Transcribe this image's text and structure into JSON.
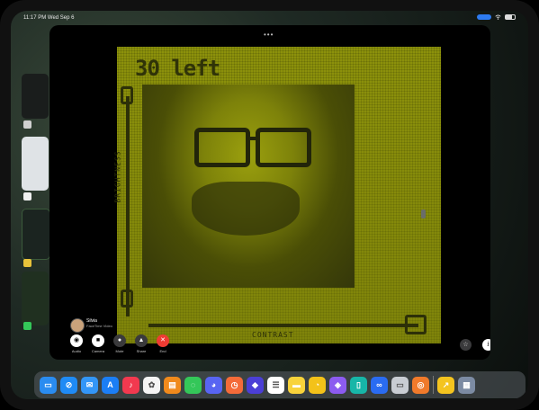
{
  "status": {
    "time": "11:17 PM   Wed Sep 6"
  },
  "camera": {
    "counter": "30 left",
    "brightness_label": "BRIGHTNESS",
    "contrast_label": "CONTRAST"
  },
  "facetime": {
    "caller_name": "Silvia",
    "caller_sub": "FaceTime Video",
    "buttons": [
      {
        "label": "Audio",
        "icon": "person-audio-icon",
        "glyph": "◉"
      },
      {
        "label": "Camera",
        "icon": "video-camera-icon",
        "glyph": "■"
      },
      {
        "label": "Mute",
        "icon": "microphone-icon",
        "glyph": "●"
      },
      {
        "label": "Share",
        "icon": "share-icon",
        "glyph": "▲"
      },
      {
        "label": "End",
        "icon": "close-icon",
        "glyph": "✕"
      }
    ]
  },
  "corner": {
    "settings_glyph": "☆",
    "info_glyph": "i"
  },
  "dock": {
    "apps": [
      {
        "name": "Files",
        "color": "#2a8cf0",
        "glyph": "▭"
      },
      {
        "name": "Safari",
        "color": "#1f8bf5",
        "glyph": "⊘"
      },
      {
        "name": "Mail",
        "color": "#3396f7",
        "glyph": "✉"
      },
      {
        "name": "App Store",
        "color": "#1b7ef5",
        "glyph": "A"
      },
      {
        "name": "Music",
        "color": "#f2394f",
        "glyph": "♪"
      },
      {
        "name": "Photos",
        "color": "#f4f4f4",
        "glyph": "✿"
      },
      {
        "name": "Books",
        "color": "#f08a1c",
        "glyph": "▤"
      },
      {
        "name": "Messages",
        "color": "#34c759",
        "glyph": "◌",
        "badge": "2"
      },
      {
        "name": "Discord",
        "color": "#5865f2",
        "glyph": "◕"
      },
      {
        "name": "Screen Time",
        "color": "#f46b39",
        "glyph": "◷"
      },
      {
        "name": "Shortcuts",
        "color": "#4b3fd6",
        "glyph": "◆"
      },
      {
        "name": "Reminders",
        "color": "#ffffff",
        "glyph": "☰"
      },
      {
        "name": "Notes",
        "color": "#f8d33b",
        "glyph": "▬"
      },
      {
        "name": "Clock",
        "color": "#f3c219",
        "glyph": "◔"
      },
      {
        "name": "Mastodon",
        "color": "#8c5bf0",
        "glyph": "◈"
      },
      {
        "name": "Frame",
        "color": "#17b6a8",
        "glyph": "▯"
      },
      {
        "name": "Links",
        "color": "#2a6cf2",
        "glyph": "∞"
      },
      {
        "name": "Display",
        "color": "#c8cdd3",
        "glyph": "▭"
      },
      {
        "name": "AirDrop",
        "color": "#f07a2b",
        "glyph": "◎"
      },
      {
        "name": "Screenshots",
        "color": "#f4c41f",
        "glyph": "↗"
      },
      {
        "name": "App Library",
        "color": "#7c8ba3",
        "glyph": "▦"
      }
    ]
  }
}
